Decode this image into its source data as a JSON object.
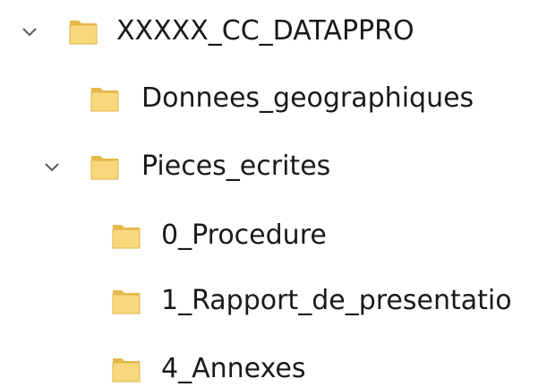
{
  "tree": {
    "items": [
      {
        "label": "XXXXX_CC_DATAPPRO",
        "level": 0,
        "expanded": true,
        "icon": "folder-icon"
      },
      {
        "label": "Donnees_geographiques",
        "level": 1,
        "expanded": false,
        "icon": "folder-icon"
      },
      {
        "label": "Pieces_ecrites",
        "level": 1,
        "expanded": true,
        "icon": "folder-icon"
      },
      {
        "label": "0_Procedure",
        "level": 2,
        "expanded": false,
        "icon": "folder-icon"
      },
      {
        "label": "1_Rapport_de_presentatio",
        "level": 2,
        "expanded": false,
        "icon": "folder-icon"
      },
      {
        "label": "4_Annexes",
        "level": 2,
        "expanded": false,
        "icon": "folder-icon"
      }
    ]
  },
  "colors": {
    "folder_body": "#f7d87c",
    "folder_shade": "#e6b94a",
    "chevron": "#5a5a5a",
    "text": "#1a1a1a"
  }
}
